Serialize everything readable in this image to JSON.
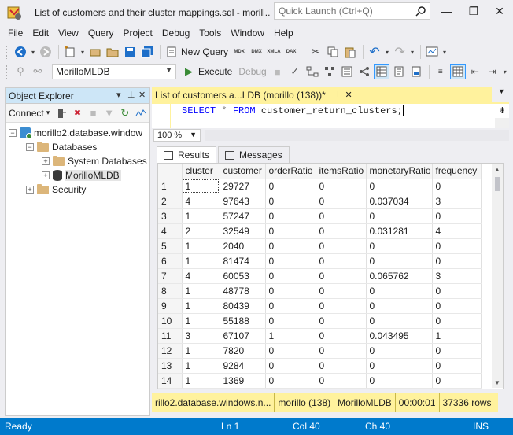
{
  "window": {
    "title": "List of customers and their cluster mappings.sql - morill...",
    "quick_launch_placeholder": "Quick Launch (Ctrl+Q)",
    "minimize": "—",
    "restore": "❐",
    "close": "✕"
  },
  "menu": [
    "File",
    "Edit",
    "View",
    "Query",
    "Project",
    "Debug",
    "Tools",
    "Window",
    "Help"
  ],
  "toolbar": {
    "new_query": "New Query",
    "database": "MorilloMLDB",
    "execute": "Execute",
    "debug": "Debug",
    "mdx": "MDX",
    "dmx": "DMX",
    "xmla": "XMLA",
    "dax": "DAX"
  },
  "object_explorer": {
    "title": "Object Explorer",
    "connect": "Connect",
    "tree": {
      "server": "morillo2.database.window",
      "databases": "Databases",
      "system_databases": "System Databases",
      "user_database": "MorilloMLDB",
      "security": "Security"
    }
  },
  "editor": {
    "tab_title": "List of customers a...LDB (morillo (138))*",
    "code": {
      "select": "SELECT",
      "star": "*",
      "from": "FROM",
      "table": "customer_return_clusters;"
    },
    "zoom": "100 %"
  },
  "results": {
    "tabs": [
      "Results",
      "Messages"
    ],
    "columns": [
      "cluster",
      "customer",
      "orderRatio",
      "itemsRatio",
      "monetaryRatio",
      "frequency"
    ],
    "rows": [
      [
        "1",
        "1",
        "29727",
        "0",
        "0",
        "0",
        "0"
      ],
      [
        "2",
        "4",
        "97643",
        "0",
        "0",
        "0.037034",
        "3"
      ],
      [
        "3",
        "1",
        "57247",
        "0",
        "0",
        "0",
        "0"
      ],
      [
        "4",
        "2",
        "32549",
        "0",
        "0",
        "0.031281",
        "4"
      ],
      [
        "5",
        "1",
        "2040",
        "0",
        "0",
        "0",
        "0"
      ],
      [
        "6",
        "1",
        "81474",
        "0",
        "0",
        "0",
        "0"
      ],
      [
        "7",
        "4",
        "60053",
        "0",
        "0",
        "0.065762",
        "3"
      ],
      [
        "8",
        "1",
        "48778",
        "0",
        "0",
        "0",
        "0"
      ],
      [
        "9",
        "1",
        "80439",
        "0",
        "0",
        "0",
        "0"
      ],
      [
        "10",
        "1",
        "55188",
        "0",
        "0",
        "0",
        "0"
      ],
      [
        "11",
        "3",
        "67107",
        "1",
        "0",
        "0.043495",
        "1"
      ],
      [
        "12",
        "1",
        "7820",
        "0",
        "0",
        "0",
        "0"
      ],
      [
        "13",
        "1",
        "9284",
        "0",
        "0",
        "0",
        "0"
      ],
      [
        "14",
        "1",
        "1369",
        "0",
        "0",
        "0",
        "0"
      ]
    ]
  },
  "query_status": {
    "server": "rillo2.database.windows.n...",
    "user": "morillo (138)",
    "database": "MorilloMLDB",
    "elapsed": "00:00:01",
    "rows": "37336 rows"
  },
  "status_bar": {
    "state": "Ready",
    "line": "Ln 1",
    "col": "Col 40",
    "ch": "Ch 40",
    "mode": "INS"
  },
  "colors": {
    "accent": "#007acc",
    "tab_yellow": "#fff29d",
    "keyword": "#0000ff"
  }
}
